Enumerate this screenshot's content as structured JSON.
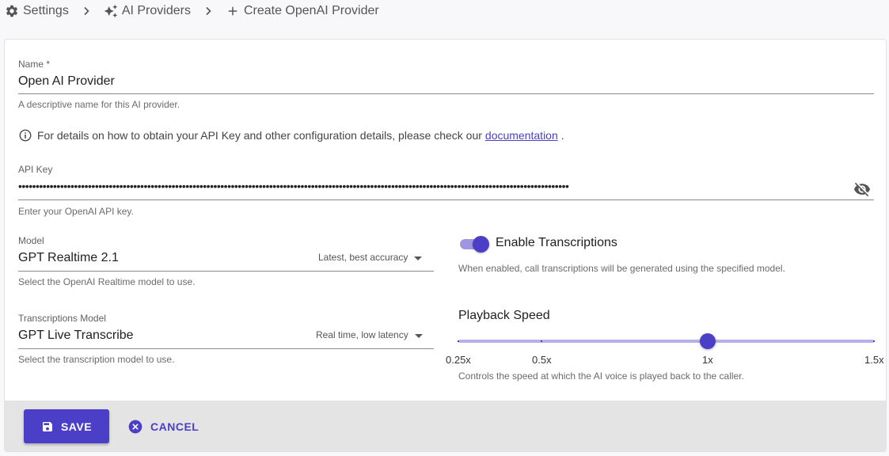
{
  "breadcrumb": {
    "items": [
      {
        "label": "Settings",
        "icon": "gear-icon"
      },
      {
        "label": "AI Providers",
        "icon": "sparkle-icon"
      },
      {
        "label": "Create OpenAI Provider",
        "icon": "plus-icon"
      }
    ]
  },
  "form": {
    "name": {
      "label": "Name *",
      "value": "Open AI Provider",
      "helper": "A descriptive name for this AI provider."
    },
    "info": {
      "text_before": "For details on how to obtain your API Key and other configuration details, please check our",
      "link": "documentation",
      "text_after": "."
    },
    "api_key": {
      "label": "API Key",
      "masked_value": "••••••••••••••••••••••••••••••••••••••••••••••••••••••••••••••••••••••••••••••••••••••••••••••••••••••••••••••••••••••••••••••••••••••••••••••••••••••••••••••",
      "helper": "Enter your OpenAI API key."
    },
    "model": {
      "label": "Model",
      "value": "GPT Realtime 2.1",
      "hint": "Latest, best accuracy",
      "helper": "Select the OpenAI Realtime model to use."
    },
    "transcriptions_model": {
      "label": "Transcriptions Model",
      "value": "GPT Live Transcribe",
      "hint": "Real time, low latency",
      "helper": "Select the transcription model to use."
    },
    "enable_transcriptions": {
      "label": "Enable Transcriptions",
      "checked": true,
      "helper": "When enabled, call transcriptions will be generated using the specified model."
    },
    "playback_speed": {
      "title": "Playback Speed",
      "value": 1,
      "min": 0.25,
      "max": 1.5,
      "ticks": [
        "0.25x",
        "0.5x",
        "1x",
        "1.5x"
      ],
      "helper": "Controls the speed at which the AI voice is played back to the caller."
    }
  },
  "footer": {
    "save_label": "SAVE",
    "cancel_label": "CANCEL"
  },
  "colors": {
    "accent": "#4a3fc6",
    "accent_light": "#b7b1ea",
    "footer_bg": "#e4e4e4"
  }
}
